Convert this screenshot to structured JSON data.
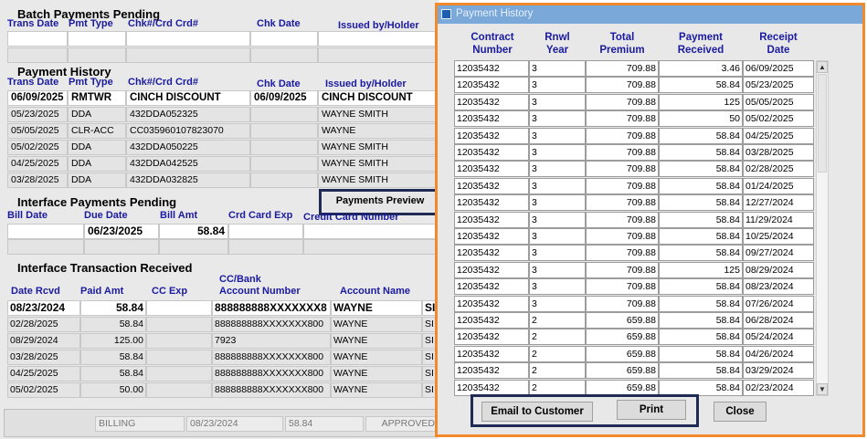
{
  "batch": {
    "title": "Batch Payments Pending",
    "headers": [
      "Trans Date",
      "Pmt Type",
      "Chk#/Crd Crd#",
      "Chk Date",
      "Issued by/Holder"
    ]
  },
  "payment_history_section": {
    "title": "Payment History",
    "headers": [
      "Trans Date",
      "Pmt Type",
      "Chk#/Crd Crd#",
      "Chk Date",
      "Issued by/Holder"
    ],
    "rows": [
      [
        "06/09/2025",
        "RMTWR",
        "CINCH DISCOUNT",
        "06/09/2025",
        "CINCH DISCOUNT"
      ],
      [
        "05/23/2025",
        "DDA",
        "432DDA052325",
        "",
        "WAYNE SMITH"
      ],
      [
        "05/05/2025",
        "CLR-ACC",
        "CC035960107823070",
        "",
        "WAYNE"
      ],
      [
        "05/02/2025",
        "DDA",
        "432DDA050225",
        "",
        "WAYNE SMITH"
      ],
      [
        "04/25/2025",
        "DDA",
        "432DDA042525",
        "",
        "WAYNE SMITH"
      ],
      [
        "03/28/2025",
        "DDA",
        "432DDA032825",
        "",
        "WAYNE SMITH"
      ]
    ],
    "preview_button": "Payments Preview"
  },
  "interface_pending": {
    "title": "Interface Payments Pending",
    "headers": [
      "Bill Date",
      "Due Date",
      "Bill Amt",
      "Crd Card Exp",
      "Credit Card Number"
    ],
    "row": [
      "",
      "06/23/2025",
      "58.84",
      "",
      ""
    ]
  },
  "interface_received": {
    "title": "Interface Transaction Received",
    "headers": [
      "Date Rcvd",
      "Paid Amt",
      "CC Exp",
      "CC/Bank",
      "Account Number",
      "Account Name"
    ],
    "rows": [
      [
        "08/23/2024",
        "58.84",
        "",
        "888888888XXXXXXX8",
        "WAYNE",
        "SI"
      ],
      [
        "02/28/2025",
        "58.84",
        "",
        "888888888XXXXXXX800",
        "WAYNE",
        "SI"
      ],
      [
        "08/29/2024",
        "125.00",
        "",
        "7923",
        "WAYNE",
        "SI"
      ],
      [
        "03/28/2025",
        "58.84",
        "",
        "888888888XXXXXXX800",
        "WAYNE",
        "SI"
      ],
      [
        "04/25/2025",
        "58.84",
        "",
        "888888888XXXXXXX800",
        "WAYNE",
        "SI"
      ],
      [
        "05/02/2025",
        "50.00",
        "",
        "888888888XXXXXXX800",
        "WAYNE",
        "SI"
      ]
    ]
  },
  "footer": [
    "BILLING",
    "08/23/2024",
    "58.84",
    "APPROVED"
  ],
  "dialog": {
    "title": "Payment History",
    "headers": [
      [
        "Contract",
        "Number"
      ],
      [
        "Rnwl",
        "Year"
      ],
      [
        "Total",
        "Premium"
      ],
      [
        "Payment",
        "Received"
      ],
      [
        "Receipt",
        "Date"
      ]
    ],
    "rows": [
      [
        "12035432",
        "3",
        "709.88",
        "3.46",
        "06/09/2025"
      ],
      [
        "12035432",
        "3",
        "709.88",
        "58.84",
        "05/23/2025"
      ],
      [
        "12035432",
        "3",
        "709.88",
        "125",
        "05/05/2025"
      ],
      [
        "12035432",
        "3",
        "709.88",
        "50",
        "05/02/2025"
      ],
      [
        "12035432",
        "3",
        "709.88",
        "58.84",
        "04/25/2025"
      ],
      [
        "12035432",
        "3",
        "709.88",
        "58.84",
        "03/28/2025"
      ],
      [
        "12035432",
        "3",
        "709.88",
        "58.84",
        "02/28/2025"
      ],
      [
        "12035432",
        "3",
        "709.88",
        "58.84",
        "01/24/2025"
      ],
      [
        "12035432",
        "3",
        "709.88",
        "58.84",
        "12/27/2024"
      ],
      [
        "12035432",
        "3",
        "709.88",
        "58.84",
        "11/29/2024"
      ],
      [
        "12035432",
        "3",
        "709.88",
        "58.84",
        "10/25/2024"
      ],
      [
        "12035432",
        "3",
        "709.88",
        "58.84",
        "09/27/2024"
      ],
      [
        "12035432",
        "3",
        "709.88",
        "125",
        "08/29/2024"
      ],
      [
        "12035432",
        "3",
        "709.88",
        "58.84",
        "08/23/2024"
      ],
      [
        "12035432",
        "3",
        "709.88",
        "58.84",
        "07/26/2024"
      ],
      [
        "12035432",
        "2",
        "659.88",
        "58.84",
        "06/28/2024"
      ],
      [
        "12035432",
        "2",
        "659.88",
        "58.84",
        "05/24/2024"
      ],
      [
        "12035432",
        "2",
        "659.88",
        "58.84",
        "04/26/2024"
      ],
      [
        "12035432",
        "2",
        "659.88",
        "58.84",
        "03/29/2024"
      ],
      [
        "12035432",
        "2",
        "659.88",
        "58.84",
        "02/23/2024"
      ]
    ],
    "buttons": {
      "email": "Email to Customer",
      "print": "Print",
      "close": "Close"
    },
    "colors": {
      "highlight_border": "#f08a2a",
      "callout_border": "#1f2a55",
      "title_bar": "#7aa8d8",
      "header_text": "#1a1aa0"
    }
  }
}
